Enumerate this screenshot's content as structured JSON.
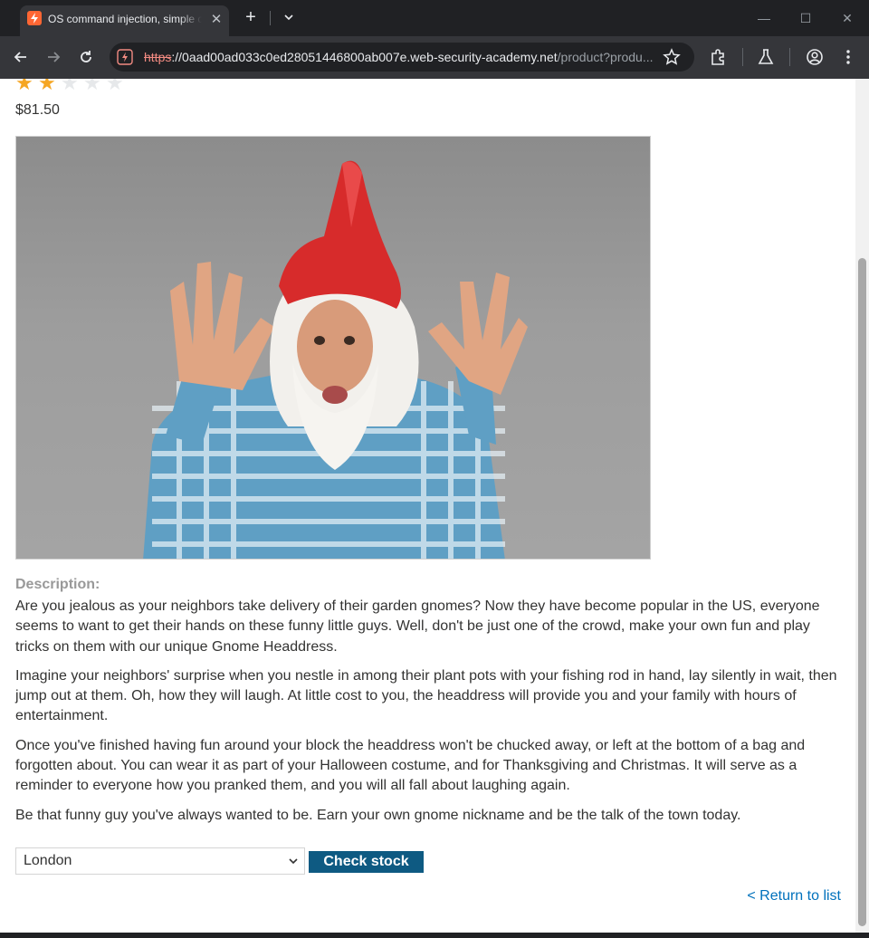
{
  "browser": {
    "tab_title": "OS command injection, simple case",
    "tab_close": "✕",
    "new_tab": "+",
    "url_scheme": "https",
    "url_host": "://0aad00ad033c0ed28051446800ab007e.web-security-academy.net",
    "url_path": "/product?produ...",
    "window_minimize": "—",
    "window_maximize": "☐",
    "window_close": "✕"
  },
  "product": {
    "rating": 2,
    "rating_max": 5,
    "price": "$81.50",
    "image_alt": "Gnome Headdress",
    "description_label": "Description:",
    "description": [
      "Are you jealous as your neighbors take delivery of their garden gnomes? Now they have become popular in the US, everyone seems to want to get their hands on these funny little guys. Well, don't be just one of the crowd, make your own fun and play tricks on them with our unique Gnome Headdress.",
      "Imagine your neighbors' surprise when you nestle in among their plant pots with your fishing rod in hand, lay silently in wait, then jump out at them. Oh, how they will laugh. At little cost to you, the headdress will provide you and your family with hours of entertainment.",
      "Once you've finished having fun around your block the headdress won't be chucked away, or left at the bottom of a bag and forgotten about. You can wear it as part of your Halloween costume, and for Thanksgiving and Christmas. It will serve as a reminder to everyone how you pranked them, and you will all fall about laughing again.",
      "Be that funny guy you've always wanted to be. Earn your own gnome nickname and be the talk of the town today."
    ]
  },
  "stock": {
    "selected_store": "London",
    "check_button": "Check stock"
  },
  "return_link": "< Return to list",
  "colors": {
    "accent_button": "#0e5a82",
    "link": "#0071bc",
    "star": "#f5a623"
  }
}
